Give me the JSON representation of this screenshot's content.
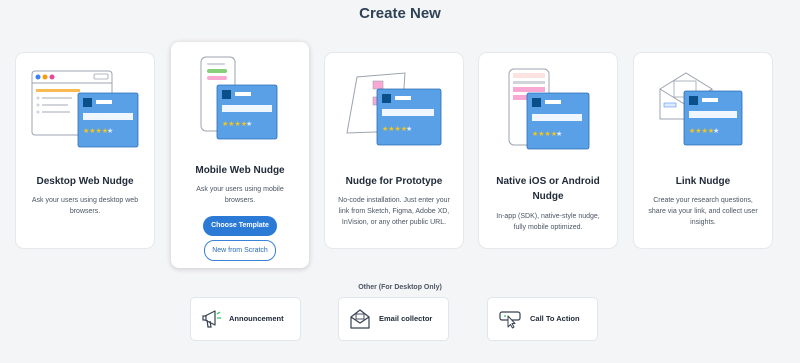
{
  "header": {
    "title": "Create New"
  },
  "cards": [
    {
      "title": "Desktop Web Nudge",
      "desc": "Ask your users using desktop web browsers."
    },
    {
      "title": "Mobile Web Nudge",
      "desc": "Ask your users using mobile browsers.",
      "primary": "Choose Template",
      "secondary": "New from Scratch"
    },
    {
      "title": "Nudge for Prototype",
      "desc": "No-code installation. Just enter your link from Sketch, Figma, Adobe XD, InVision, or any other public URL."
    },
    {
      "title": "Native iOS or Android Nudge",
      "desc": "In-app (SDK), native-style nudge, fully mobile optimized."
    },
    {
      "title": "Link Nudge",
      "desc": "Create your research questions, share via your link, and collect user insights."
    }
  ],
  "other": {
    "label": "Other (For Desktop Only)",
    "items": [
      {
        "label": "Announcement",
        "icon": "megaphone-icon"
      },
      {
        "label": "Email collector",
        "icon": "envelope-icon"
      },
      {
        "label": "Call To Action",
        "icon": "cursor-click-icon"
      }
    ]
  },
  "colors": {
    "accent": "#2b7bd6",
    "card_blue": "#5aa0e6",
    "star": "#f5c518",
    "title": "#2f4256"
  }
}
